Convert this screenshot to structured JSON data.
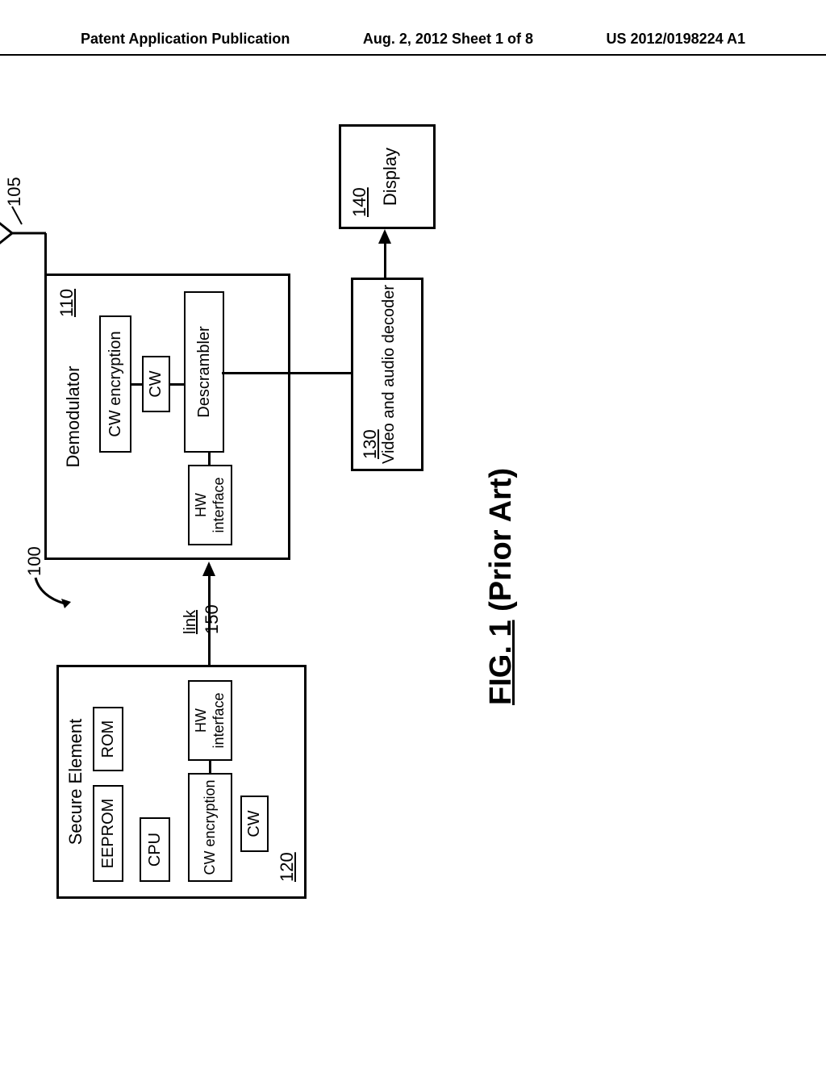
{
  "header": {
    "left": "Patent Application Publication",
    "center": "Aug. 2, 2012  Sheet 1 of 8",
    "right": "US 2012/0198224 A1"
  },
  "refs": {
    "system": "100",
    "antenna": "105",
    "demodulator": "110",
    "secure_element": "120",
    "decoder": "130",
    "display": "140",
    "link": "150"
  },
  "labels": {
    "secure_element": "Secure Element",
    "eeprom": "EEPROM",
    "rom": "ROM",
    "cpu": "CPU",
    "cw_encryption": "CW encryption",
    "cw": "CW",
    "hw_interface": "HW interface",
    "link": "link",
    "demodulator": "Demodulator",
    "descrambler": "Descrambler",
    "decoder": "Video and audio decoder",
    "display": "Display"
  },
  "caption": "FIG. 1 (Prior Art)"
}
